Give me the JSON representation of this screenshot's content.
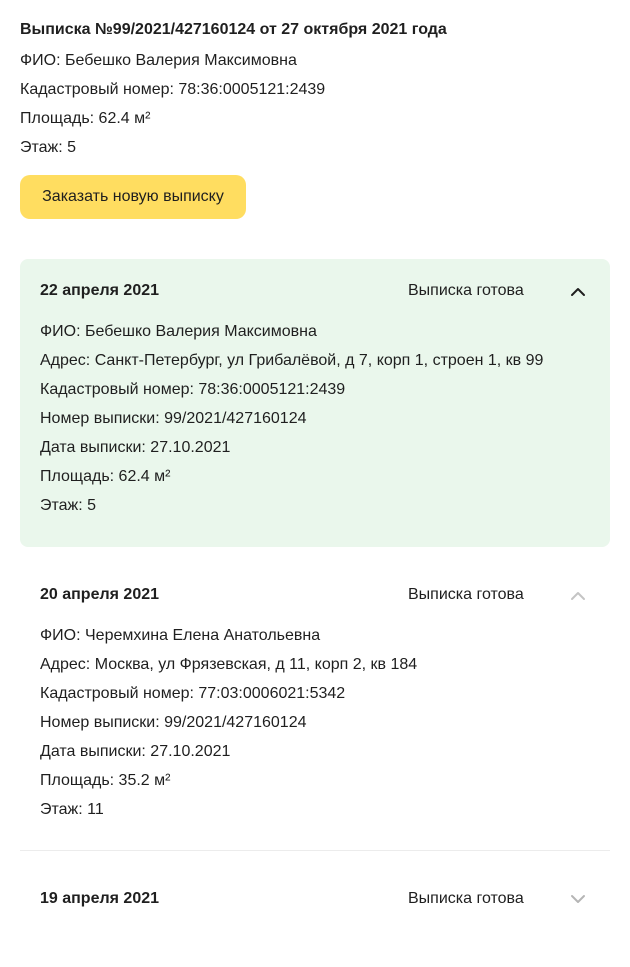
{
  "summary": {
    "title": "Выписка №99/2021/427160124 от 27 октября 2021 года",
    "fio": "ФИО: Бебешко Валерия Максимовна",
    "cadastral": "Кадастровый номер: 78:36:0005121:2439",
    "area": "Площадь: 62.4 м²",
    "floor": "Этаж: 5"
  },
  "order_button": {
    "label": "Заказать новую выписку",
    "color": "#ffdd60"
  },
  "cards": [
    {
      "date": "22 апреля 2021",
      "status": "Выписка готова",
      "expanded": true,
      "highlight_color": "#eaf7ec",
      "chevron_icon": "chevron-up-icon",
      "lines": {
        "fio": "ФИО: Бебешко Валерия Максимовна",
        "address": "Адрес: Санкт-Петербург, ул Грибалёвой, д 7, корп 1, строен 1, кв 99",
        "cadastral": "Кадастровый номер: 78:36:0005121:2439",
        "extract_number": "Номер выписки: 99/2021/427160124",
        "extract_date": "Дата выписки: 27.10.2021",
        "area": "Площадь: 62.4 м²",
        "floor": "Этаж: 5"
      }
    },
    {
      "date": "20 апреля 2021",
      "status": "Выписка готова",
      "expanded": true,
      "chevron_icon": "chevron-up-icon",
      "lines": {
        "fio": "ФИО: Черемхина Елена Анатольевна",
        "address": "Адрес: Москва, ул Фрязевская, д 11, корп 2, кв 184",
        "cadastral": "Кадастровый номер: 77:03:0006021:5342",
        "extract_number": "Номер выписки: 99/2021/427160124",
        "extract_date": "Дата выписки: 27.10.2021",
        "area": "Площадь: 35.2 м²",
        "floor": "Этаж: 11"
      }
    },
    {
      "date": "19 апреля 2021",
      "status": "Выписка готова",
      "expanded": false,
      "chevron_icon": "chevron-down-icon"
    }
  ]
}
